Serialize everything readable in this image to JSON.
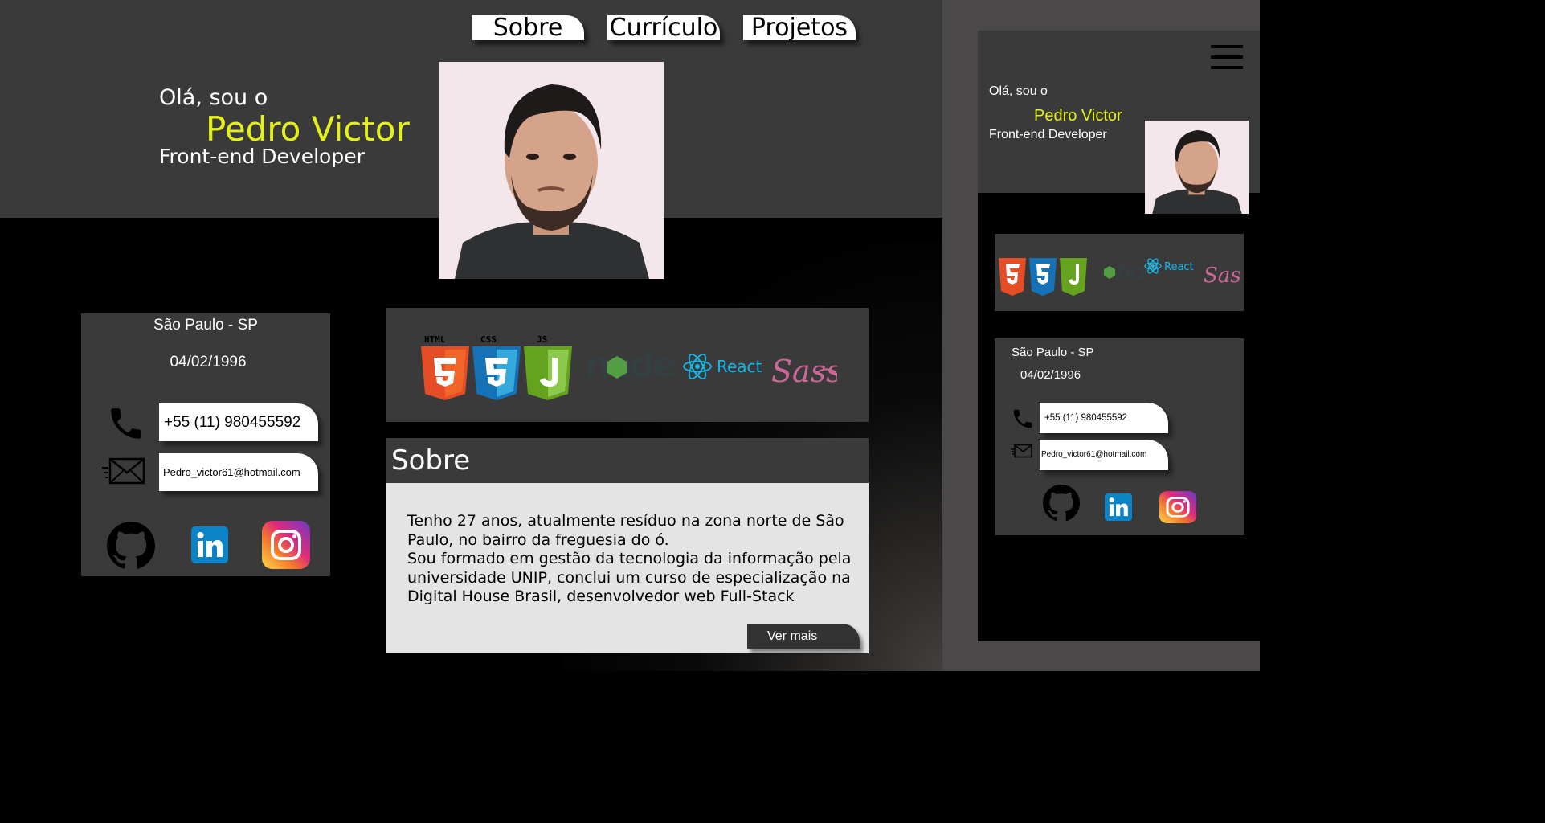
{
  "nav": {
    "items": [
      {
        "label": "Sobre"
      },
      {
        "label": "Currículo"
      },
      {
        "label": "Projetos"
      }
    ]
  },
  "hero": {
    "greeting": "Olá, sou o",
    "name": "Pedro Victor",
    "role": "Front-end Developer"
  },
  "contact": {
    "city": "São Paulo - SP",
    "birthdate": "04/02/1996",
    "phone": "+55 (11) 980455592",
    "email": "Pedro_victor61@hotmail.com",
    "social_icons": [
      "github-icon",
      "linkedin-icon",
      "instagram-icon"
    ]
  },
  "tech": {
    "logos": [
      {
        "icon": "html5-icon",
        "label": "HTML"
      },
      {
        "icon": "css3-icon",
        "label": "CSS"
      },
      {
        "icon": "js-icon",
        "label": "JS"
      },
      {
        "icon": "nodejs-icon",
        "label": "node"
      },
      {
        "icon": "react-icon",
        "label": "React"
      },
      {
        "icon": "sass-icon",
        "label": "Sass"
      }
    ]
  },
  "about": {
    "title": "Sobre",
    "text": "Tenho 27 anos, atualmente resíduo na zona norte de São Paulo, no bairro da freguesia do ó.\nSou formado em gestão da tecnologia da informação pela universidade UNIP, conclui um curso de especialização na Digital House Brasil, desenvolvedor web Full-Stack",
    "more_label": "Ver mais"
  },
  "colors": {
    "accent": "#e4f01b",
    "panel": "#3a3a3a",
    "background": "#000000",
    "about_bg": "#e4e4e4"
  }
}
